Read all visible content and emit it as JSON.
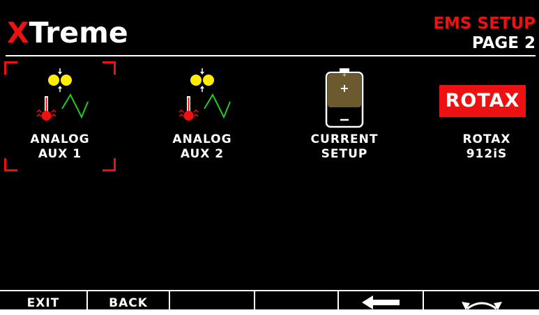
{
  "header": {
    "app_title_first": "X",
    "app_title_rest": "Treme",
    "setup_title": "EMS SETUP",
    "page_label": "PAGE 2"
  },
  "menu": {
    "items": [
      {
        "line1": "ANALOG",
        "line2": "AUX 1",
        "icon": "analog-sensor-icon",
        "selected": true
      },
      {
        "line1": "ANALOG",
        "line2": "AUX 2",
        "icon": "analog-sensor-icon",
        "selected": false
      },
      {
        "line1": "CURRENT",
        "line2": "SETUP",
        "icon": "battery-icon",
        "selected": false
      },
      {
        "line1": "ROTAX",
        "line2": "912iS",
        "icon": "rotax-logo",
        "badge": "ROTAX",
        "selected": false
      }
    ]
  },
  "softkeys": {
    "exit": "EXIT",
    "back": "BACK",
    "left_arrow_icon": "left-arrow-icon",
    "cycle_icon": "cycle-arrows-icon"
  },
  "colors": {
    "accent_red": "#ee1111",
    "background": "#000000",
    "indicator_yellow": "#ffee00",
    "graph_green": "#22cc22",
    "battery_brown": "#6b5a2e"
  }
}
